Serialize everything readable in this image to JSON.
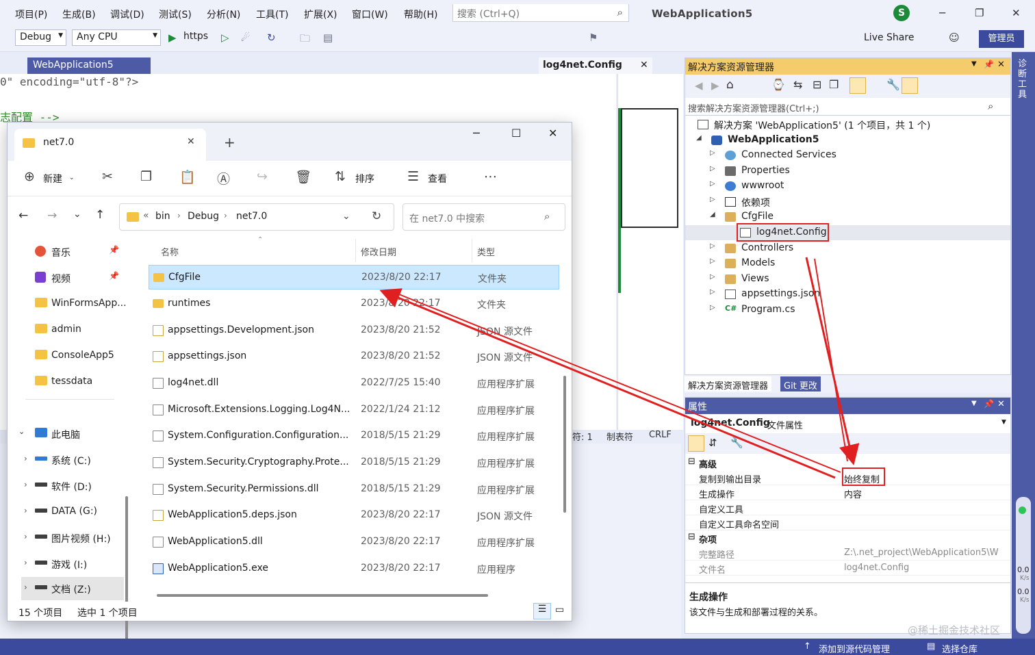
{
  "vs": {
    "menus": [
      "项目(P)",
      "生成(B)",
      "调试(D)",
      "测试(S)",
      "分析(N)",
      "工具(T)",
      "扩展(X)",
      "窗口(W)",
      "帮助(H)"
    ],
    "search_placeholder": "搜索 (Ctrl+Q)",
    "title": "WebApplication5",
    "avatar_initial": "S",
    "config_combo": "Debug",
    "platform_combo": "Any CPU",
    "run_label": "https",
    "live_share": "Live Share",
    "admin_label": "管理员"
  },
  "editor": {
    "tab_main": "WebApplication5",
    "tab_right": "log4net.Config",
    "line1": "0\" encoding=\"utf-8\"?>",
    "line2": "志配置 -->",
    "status_chars": "符: 1",
    "status_tab": "制表符",
    "status_eol": "CRLF"
  },
  "explorer": {
    "tab_title": "net7.0",
    "cmd_new": "新建",
    "cmd_sort": "排序",
    "cmd_view": "查看",
    "breadcrumb": [
      "bin",
      "Debug",
      "net7.0"
    ],
    "search_placeholder": "在 net7.0 中搜索",
    "columns": {
      "name": "名称",
      "date": "修改日期",
      "type": "类型"
    },
    "sidebar": [
      {
        "label": "音乐",
        "kind": "music"
      },
      {
        "label": "视频",
        "kind": "video"
      },
      {
        "label": "WinFormsApp...",
        "kind": "folder"
      },
      {
        "label": "admin",
        "kind": "folder"
      },
      {
        "label": "ConsoleApp5",
        "kind": "folder"
      },
      {
        "label": "tessdata",
        "kind": "folder"
      }
    ],
    "pc_label": "此电脑",
    "drives": [
      "系统 (C:)",
      "软件 (D:)",
      "DATA (G:)",
      "图片视频 (H:)",
      "游戏 (I:)",
      "文档 (Z:)"
    ],
    "files": [
      {
        "name": "CfgFile",
        "date": "2023/8/20 22:17",
        "type": "文件夹",
        "kind": "folder"
      },
      {
        "name": "runtimes",
        "date": "2023/8/20 22:17",
        "type": "文件夹",
        "kind": "folder"
      },
      {
        "name": "appsettings.Development.json",
        "date": "2023/8/20 21:52",
        "type": "JSON 源文件",
        "kind": "json"
      },
      {
        "name": "appsettings.json",
        "date": "2023/8/20 21:52",
        "type": "JSON 源文件",
        "kind": "json"
      },
      {
        "name": "log4net.dll",
        "date": "2022/7/25 15:40",
        "type": "应用程序扩展",
        "kind": "dll"
      },
      {
        "name": "Microsoft.Extensions.Logging.Log4N...",
        "date": "2022/1/24 21:12",
        "type": "应用程序扩展",
        "kind": "dll"
      },
      {
        "name": "System.Configuration.Configuration...",
        "date": "2018/5/15 21:29",
        "type": "应用程序扩展",
        "kind": "dll"
      },
      {
        "name": "System.Security.Cryptography.Prote...",
        "date": "2018/5/15 21:29",
        "type": "应用程序扩展",
        "kind": "dll"
      },
      {
        "name": "System.Security.Permissions.dll",
        "date": "2018/5/15 21:29",
        "type": "应用程序扩展",
        "kind": "dll"
      },
      {
        "name": "WebApplication5.deps.json",
        "date": "2023/8/20 22:17",
        "type": "JSON 源文件",
        "kind": "json"
      },
      {
        "name": "WebApplication5.dll",
        "date": "2023/8/20 22:17",
        "type": "应用程序扩展",
        "kind": "dll"
      },
      {
        "name": "WebApplication5.exe",
        "date": "2023/8/20 22:17",
        "type": "应用程序",
        "kind": "exe"
      }
    ],
    "status_count": "15 个项目",
    "status_selected": "选中 1 个项目"
  },
  "solution": {
    "header": "解决方案资源管理器",
    "search_placeholder": "搜索解决方案资源管理器(Ctrl+;)",
    "root": "解决方案 'WebApplication5' (1 个项目，共 1 个)",
    "project": "WebApplication5",
    "items": [
      "Connected Services",
      "Properties",
      "wwwroot",
      "依赖项",
      "CfgFile"
    ],
    "cfg_child": "log4net.Config",
    "items2": [
      "Controllers",
      "Models",
      "Views",
      "appsettings.json",
      "Program.cs"
    ],
    "tab_active": "解决方案资源管理器",
    "tab_git": "Git 更改"
  },
  "properties": {
    "header": "属性",
    "object_name": "log4net.Config",
    "object_type": "文件属性",
    "cat_advanced": "高级",
    "rows_adv": [
      {
        "key": "复制到输出目录",
        "value": "始终复制"
      },
      {
        "key": "生成操作",
        "value": "内容"
      },
      {
        "key": "自定义工具",
        "value": ""
      },
      {
        "key": "自定义工具命名空间",
        "value": ""
      }
    ],
    "cat_misc": "杂项",
    "rows_misc": [
      {
        "key": "完整路径",
        "value": "Z:\\.net_project\\WebApplication5\\W"
      },
      {
        "key": "文件名",
        "value": "log4net.Config"
      }
    ],
    "desc_title": "生成操作",
    "desc_text": "该文件与生成和部署过程的关系。"
  },
  "right_strip": {
    "label": "诊断工具",
    "rate1": "0.0",
    "unit1": "K/s",
    "rate2": "0.0",
    "unit2": "K/s"
  },
  "statusbar": {
    "source_control": "添加到源代码管理",
    "repo": "选择仓库"
  },
  "watermark": "@稀土掘金技术社区",
  "colors": {
    "accent": "#4d5aa6",
    "highlight": "#f5cc6b",
    "annotation": "#e02020",
    "selection": "#cce8ff"
  }
}
